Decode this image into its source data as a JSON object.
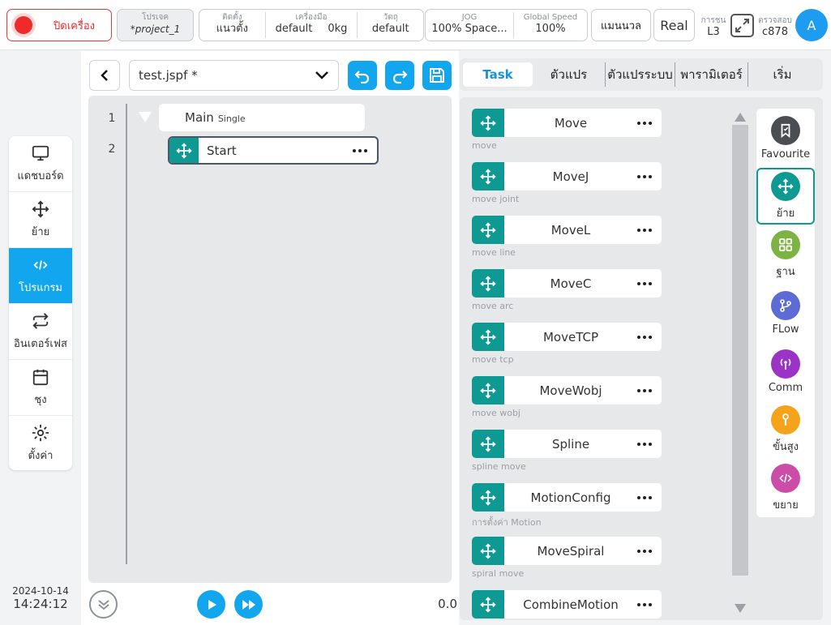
{
  "header": {
    "emergency_stop_label": "ปิดเครื่อง",
    "project": {
      "caption": "โปรเจค",
      "value": "*project_1"
    },
    "install": {
      "caption": "ติดตั้ง",
      "value": "แนวตั้ง"
    },
    "tool": {
      "caption": "เครื่องมือ",
      "name": "default",
      "weight": "0kg"
    },
    "workpiece": {
      "caption": "วัตถุ",
      "value": "default"
    },
    "jog": {
      "caption": "JOG",
      "value": "100%",
      "space": "Space..."
    },
    "global_speed": {
      "caption": "Global Speed",
      "value": "100%"
    },
    "mode_label": "แมนนวล",
    "real_label": "Real",
    "collision": {
      "caption": "การชน",
      "value": "L3"
    },
    "check": {
      "caption": "ตรวจสอบ",
      "value": "c878"
    },
    "avatar_letter": "A"
  },
  "nav": {
    "items": [
      {
        "label": "แดชบอร์ด",
        "icon": "monitor-icon",
        "active": false
      },
      {
        "label": "ย้าย",
        "icon": "move-icon",
        "active": false
      },
      {
        "label": "โปรแกรม",
        "icon": "code-icon",
        "active": true
      },
      {
        "label": "อินเตอร์เฟส",
        "icon": "interface-icon",
        "active": false
      },
      {
        "label": "ชุง",
        "icon": "calendar-icon",
        "active": false
      },
      {
        "label": "ตั้งค่า",
        "icon": "gear-icon",
        "active": false
      }
    ]
  },
  "datetime": {
    "date": "2024-10-14",
    "time": "14:24:12"
  },
  "editor": {
    "file_name": "test.jspf *",
    "lines": [
      "1",
      "2"
    ],
    "main_node": {
      "label": "Main",
      "sub": "Single"
    },
    "start_node": {
      "label": "Start"
    },
    "speed_value": "0.0"
  },
  "tabs": [
    {
      "label": "Task",
      "active": true
    },
    {
      "label": "ตัวแปร",
      "active": false
    },
    {
      "label": "ตัวแปรระบบ",
      "active": false
    },
    {
      "label": "พารามิเตอร์",
      "active": false
    },
    {
      "label": "เริ่ม",
      "active": false
    }
  ],
  "tasks": [
    {
      "name": "Move",
      "desc": "move"
    },
    {
      "name": "MoveJ",
      "desc": "move joint"
    },
    {
      "name": "MoveL",
      "desc": "move line"
    },
    {
      "name": "MoveC",
      "desc": "move arc"
    },
    {
      "name": "MoveTCP",
      "desc": "move tcp"
    },
    {
      "name": "MoveWobj",
      "desc": "move wobj"
    },
    {
      "name": "Spline",
      "desc": "spline move"
    },
    {
      "name": "MotionConfig",
      "desc": "การตั้งค่า Motion"
    },
    {
      "name": "MoveSpiral",
      "desc": "spiral move"
    },
    {
      "name": "CombineMotion",
      "desc": ""
    }
  ],
  "categories": [
    {
      "label": "Favourite",
      "icon": "bookmark-icon",
      "color": "#4a4d52",
      "active": false
    },
    {
      "label": "ย้าย",
      "icon": "move-icon",
      "color": "#0e9a92",
      "active": true
    },
    {
      "label": "ฐาน",
      "icon": "grid-icon",
      "color": "#7cb342",
      "active": false
    },
    {
      "label": "FLow",
      "icon": "branch-icon",
      "color": "#5c6bd6",
      "active": false
    },
    {
      "label": "Comm",
      "icon": "antenna-icon",
      "color": "#9c33c7",
      "active": false
    },
    {
      "label": "ขั้นสูง",
      "icon": "wrench-icon",
      "color": "#f5a31a",
      "active": false
    },
    {
      "label": "ขยาย",
      "icon": "code-icon",
      "color": "#cc4da8",
      "active": false
    }
  ]
}
